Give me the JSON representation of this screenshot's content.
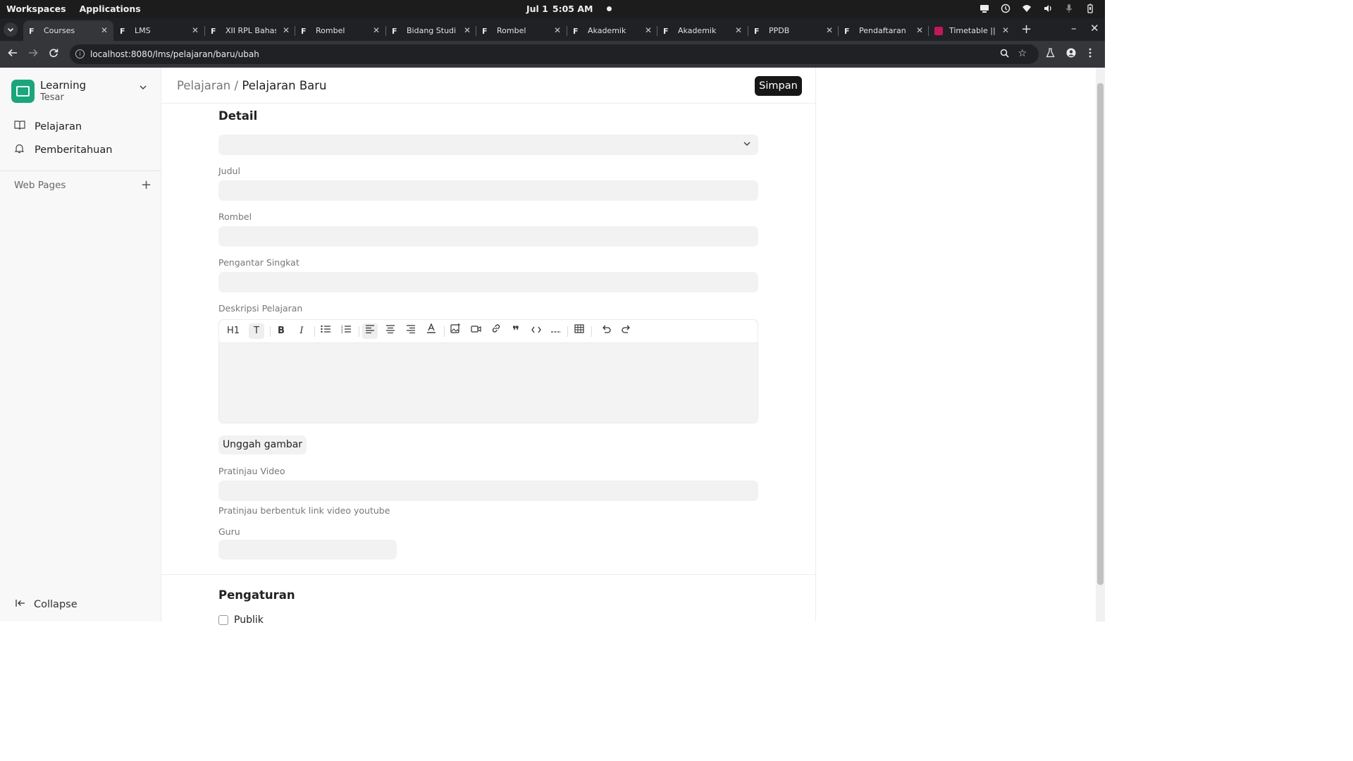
{
  "os": {
    "workspaces": "Workspaces",
    "applications": "Applications",
    "date": "Jul 1",
    "time": "5:05 AM"
  },
  "tabs": [
    {
      "label": "Courses"
    },
    {
      "label": "LMS"
    },
    {
      "label": "XII RPL Bahasa"
    },
    {
      "label": "Rombel"
    },
    {
      "label": "Bidang Studi"
    },
    {
      "label": "Rombel"
    },
    {
      "label": "Akademik"
    },
    {
      "label": "Akademik"
    },
    {
      "label": "PPDB"
    },
    {
      "label": "Pendaftaran"
    },
    {
      "label": "Timetable || e"
    }
  ],
  "browser": {
    "url": "localhost:8080/lms/pelajaran/baru/ubah"
  },
  "sidebar": {
    "app_name": "Learning",
    "user": "Tesar",
    "items": [
      {
        "label": "Pelajaran"
      },
      {
        "label": "Pemberitahuan"
      }
    ],
    "web_pages": "Web Pages",
    "collapse": "Collapse"
  },
  "header": {
    "crumb_parent": "Pelajaran",
    "crumb_sep": "/",
    "crumb_current": "Pelajaran Baru",
    "save": "Simpan"
  },
  "form": {
    "detail_title": "Detail",
    "judul": "Judul",
    "rombel": "Rombel",
    "pengantar": "Pengantar Singkat",
    "deskripsi": "Deskripsi Pelajaran",
    "upload": "Unggah gambar",
    "video": "Pratinjau Video",
    "video_hint": "Pratinjau berbentuk link video youtube",
    "guru": "Guru",
    "pengaturan": "Pengaturan",
    "publik": "Publik"
  },
  "toolbar": {
    "heading": "H1",
    "text": "T",
    "bold": "B",
    "italic": "I"
  }
}
